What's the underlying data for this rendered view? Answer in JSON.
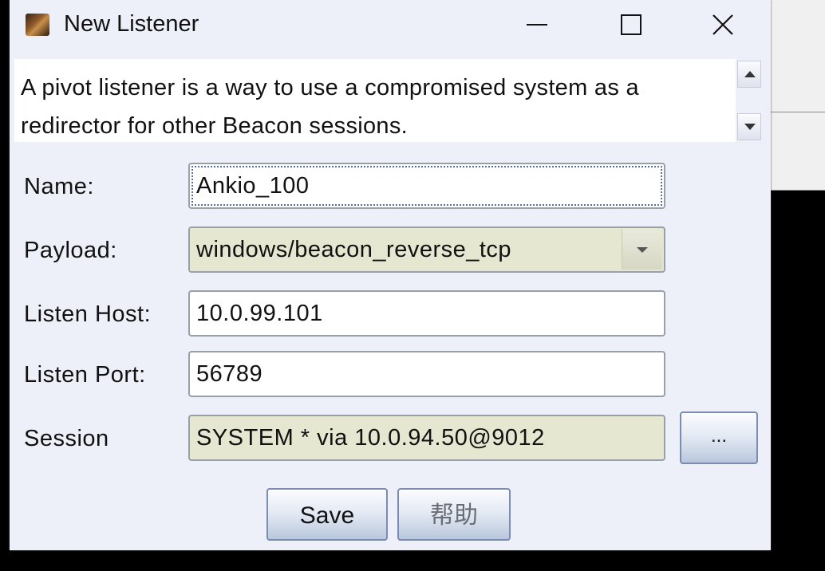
{
  "window": {
    "title": "New Listener",
    "description": "A pivot listener is a way to use a compromised system as a redirector for other Beacon sessions."
  },
  "form": {
    "name_label": "Name:",
    "name_value": "Ankio_100",
    "payload_label": "Payload:",
    "payload_value": "windows/beacon_reverse_tcp",
    "listen_host_label": "Listen Host:",
    "listen_host_value": "10.0.99.101",
    "listen_port_label": "Listen Port:",
    "listen_port_value": "56789",
    "session_label": "Session",
    "session_value": "SYSTEM * via  10.0.94.50@9012",
    "browse_label": "..."
  },
  "buttons": {
    "save": "Save",
    "help": "帮助"
  },
  "icons": {
    "app": "app-icon",
    "minimize": "minimize-icon",
    "maximize": "maximize-icon",
    "close": "close-icon",
    "scroll_up": "scroll-up-icon",
    "scroll_down": "scroll-down-icon",
    "combo": "chevron-down-icon"
  }
}
